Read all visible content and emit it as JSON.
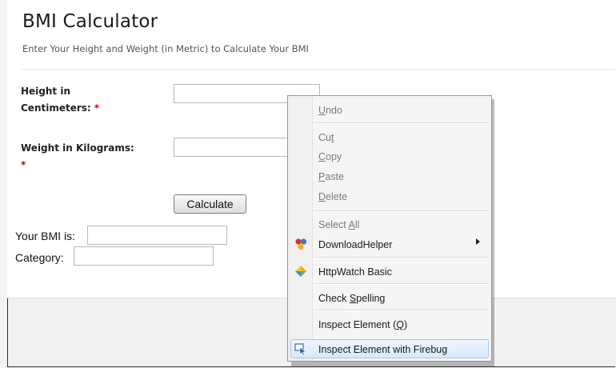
{
  "page": {
    "title": "BMI Calculator",
    "subtitle": "Enter Your Height and Weight (in Metric) to Calculate Your BMI"
  },
  "form": {
    "height_label_line1": "Height in",
    "height_label_line2": "Centimeters:",
    "weight_label": "Weight in Kilograms:",
    "required_mark": "*",
    "height_value": "",
    "weight_value": "",
    "calculate_label": "Calculate",
    "bmi_label": "Your BMI is:",
    "bmi_value": "",
    "category_label": "Category:",
    "category_value": ""
  },
  "context_menu": {
    "items": [
      {
        "pre": "",
        "key": "U",
        "post": "ndo",
        "enabled": false
      },
      {
        "pre": "Cu",
        "key": "t",
        "post": "",
        "enabled": false
      },
      {
        "pre": "",
        "key": "C",
        "post": "opy",
        "enabled": false
      },
      {
        "pre": "",
        "key": "P",
        "post": "aste",
        "enabled": false
      },
      {
        "pre": "",
        "key": "D",
        "post": "elete",
        "enabled": false
      },
      {
        "pre": "Select ",
        "key": "A",
        "post": "ll",
        "enabled": false
      },
      {
        "label": "DownloadHelper",
        "icon": "downloadhelper-icon",
        "submenu": true
      },
      {
        "label": "HttpWatch Basic",
        "icon": "httpwatch-icon"
      },
      {
        "pre": "Check ",
        "key": "S",
        "post": "pelling"
      },
      {
        "pre": "Inspect Element (",
        "key": "Q",
        "post": ")"
      },
      {
        "label": "Inspect Element with Firebug",
        "icon": "firebug-inspect-icon",
        "highlighted": true
      }
    ]
  },
  "colors": {
    "required": "#d00000",
    "highlight": "#d9e9fa"
  }
}
